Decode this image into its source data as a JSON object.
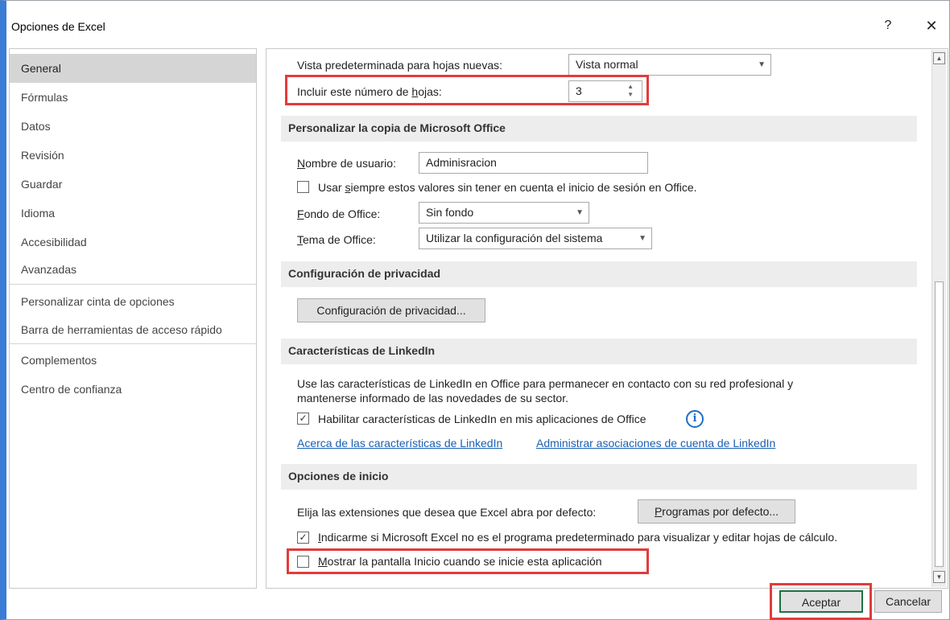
{
  "window": {
    "title": "Opciones de Excel",
    "help": "?",
    "close": "✕"
  },
  "sidebar": {
    "items": [
      {
        "label": "General"
      },
      {
        "label": "Fórmulas"
      },
      {
        "label": "Datos"
      },
      {
        "label": "Revisión"
      },
      {
        "label": "Guardar"
      },
      {
        "label": "Idioma"
      },
      {
        "label": "Accesibilidad"
      },
      {
        "label": "Avanzadas"
      },
      {
        "label": "Personalizar cinta de opciones"
      },
      {
        "label": "Barra de herramientas de acceso rápido"
      },
      {
        "label": "Complementos"
      },
      {
        "label": "Centro de confianza"
      }
    ],
    "active": "General"
  },
  "general": {
    "default_view": {
      "label": "Vista predeterminada para hojas nuevas:",
      "value": "Vista normal"
    },
    "sheets_count": {
      "label_pre": "Incluir este número de ",
      "label_ul": "h",
      "label_post": "ojas:",
      "value": "3"
    }
  },
  "personalize": {
    "header": "Personalizar la copia de Microsoft Office",
    "username": {
      "label_ul": "N",
      "label_post": "ombre de usuario:",
      "value": "Adminisracion"
    },
    "always_use": {
      "pre": "Usar ",
      "ul": "s",
      "post": "iempre estos valores sin tener en cuenta el inicio de sesión en Office.",
      "checked": false
    },
    "background": {
      "label_ul": "F",
      "label_post": "ondo de Office:",
      "value": "Sin fondo"
    },
    "theme": {
      "label_ul": "T",
      "label_post": "ema de Office:",
      "value": "Utilizar la configuración del sistema"
    }
  },
  "privacy": {
    "header": "Configuración de privacidad",
    "button": "Configuración de privacidad..."
  },
  "linkedin": {
    "header": "Características de LinkedIn",
    "desc_line1": "Use las características de LinkedIn en Office para permanecer en contacto con su red profesional y",
    "desc_line2": "mantenerse informado de las novedades de su sector.",
    "enable": {
      "label": "Habilitar características de LinkedIn en mis aplicaciones de Office",
      "checked": true
    },
    "link_about": "Acerca de las características de LinkedIn",
    "link_manage": "Administrar asociaciones de cuenta de LinkedIn"
  },
  "startup": {
    "header": "Opciones de inicio",
    "extensions_label": "Elija las extensiones que desea que Excel abra por defecto:",
    "default_programs_ul": "P",
    "default_programs_post": "rogramas por defecto...",
    "notify": {
      "ul": "I",
      "post": "ndicarme si Microsoft Excel no es el programa predeterminado para visualizar y editar hojas de cálculo.",
      "checked": true
    },
    "show_start": {
      "ul": "M",
      "post": "ostrar la pantalla Inicio cuando se inicie esta aplicación",
      "checked": false
    }
  },
  "footer": {
    "ok": "Aceptar",
    "cancel": "Cancelar"
  },
  "colors": {
    "highlight": "#e23b3b",
    "link": "#1a5fb4",
    "accent": "#3b7cd6",
    "ok_border": "#1e7145"
  }
}
